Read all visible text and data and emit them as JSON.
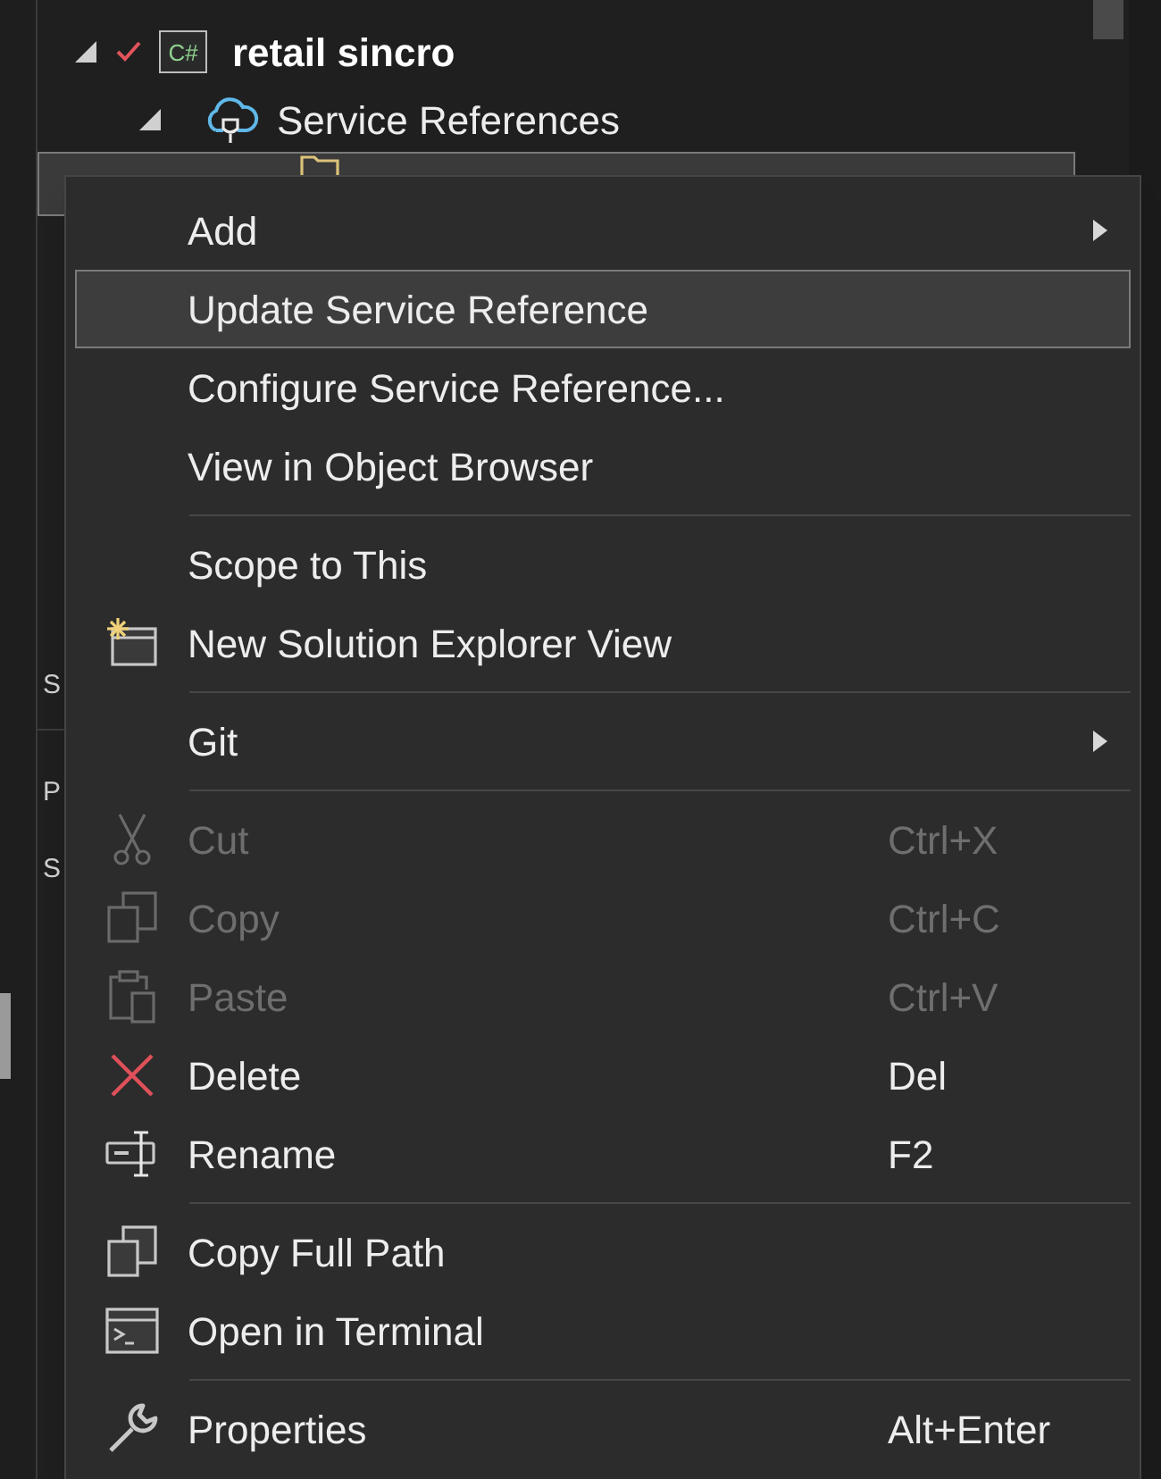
{
  "tree": {
    "items": [
      {
        "label": "retail sincro",
        "badge": "C#",
        "expanded": true,
        "checked": true,
        "kind": "project"
      },
      {
        "label": "Service References",
        "expanded": true,
        "kind": "folder"
      }
    ],
    "selected_row": {
      "selected": true
    }
  },
  "side_panels": [
    {
      "label": "S"
    },
    {
      "label": "P"
    },
    {
      "label": "S"
    }
  ],
  "context_menu": {
    "items": [
      {
        "kind": "item",
        "label": "Add",
        "submenu": true,
        "selected": false,
        "disabled": false
      },
      {
        "kind": "item",
        "label": "Update Service Reference",
        "selected": true,
        "disabled": false
      },
      {
        "kind": "item",
        "label": "Configure Service Reference...",
        "selected": false,
        "disabled": false
      },
      {
        "kind": "item",
        "label": "View in Object Browser",
        "selected": false,
        "disabled": false
      },
      {
        "kind": "separator"
      },
      {
        "kind": "item",
        "label": "Scope to This",
        "selected": false,
        "disabled": false
      },
      {
        "kind": "item",
        "label": "New Solution Explorer View",
        "selected": false,
        "disabled": false
      },
      {
        "kind": "separator"
      },
      {
        "kind": "item",
        "label": "Git",
        "submenu": true,
        "selected": false,
        "disabled": false
      },
      {
        "kind": "separator"
      },
      {
        "kind": "item",
        "label": "Cut",
        "shortcut": "Ctrl+X",
        "selected": false,
        "disabled": true
      },
      {
        "kind": "item",
        "label": "Copy",
        "shortcut": "Ctrl+C",
        "selected": false,
        "disabled": true
      },
      {
        "kind": "item",
        "label": "Paste",
        "shortcut": "Ctrl+V",
        "selected": false,
        "disabled": true
      },
      {
        "kind": "item",
        "label": "Delete",
        "shortcut": "Del",
        "selected": false,
        "disabled": false
      },
      {
        "kind": "item",
        "label": "Rename",
        "shortcut": "F2",
        "selected": false,
        "disabled": false
      },
      {
        "kind": "separator"
      },
      {
        "kind": "item",
        "label": "Copy Full Path",
        "selected": false,
        "disabled": false
      },
      {
        "kind": "item",
        "label": "Open in Terminal",
        "selected": false,
        "disabled": false
      },
      {
        "kind": "separator"
      },
      {
        "kind": "item",
        "label": "Properties",
        "shortcut": "Alt+Enter",
        "selected": false,
        "disabled": false
      }
    ]
  }
}
